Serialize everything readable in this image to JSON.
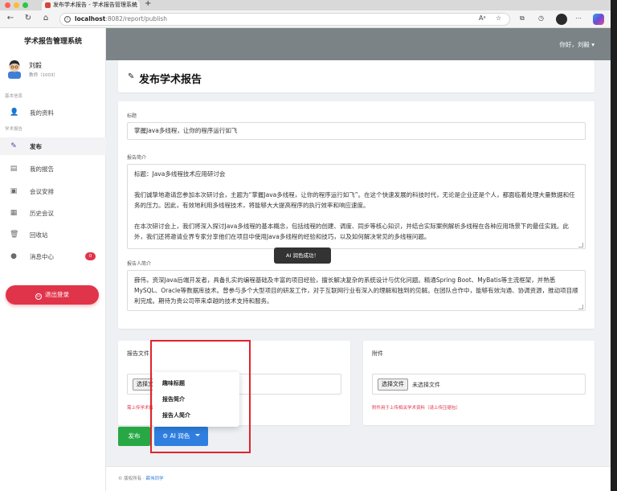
{
  "browser": {
    "tab_title": "发布学术报告 - 学术报告管理系统",
    "url_host": "localhost",
    "url_rest": ":8082/report/publish",
    "traffic_colors": [
      "#ff5f57",
      "#febc2e",
      "#28c840"
    ]
  },
  "sidebar": {
    "brand": "学术报告管理系统",
    "user_name": "刘毅",
    "user_role": "教师（1003）",
    "section_basic": "基本信息",
    "section_reports": "学术报告",
    "items": [
      {
        "label": "我的资料",
        "icon": "user-icon",
        "glyph": "👤"
      },
      {
        "label": "发布",
        "icon": "edit-icon",
        "glyph": "✎"
      },
      {
        "label": "我的报告",
        "icon": "report-icon",
        "glyph": "▤"
      },
      {
        "label": "会议安排",
        "icon": "calendar-icon",
        "glyph": "▣"
      },
      {
        "label": "历史会议",
        "icon": "history-icon",
        "glyph": "▦"
      },
      {
        "label": "回收站",
        "icon": "trash-icon",
        "glyph": "🗑"
      },
      {
        "label": "消息中心",
        "icon": "message-icon",
        "glyph": "●"
      }
    ],
    "message_badge": "0",
    "logout_label": "退出登录",
    "active_color": "#4a3f9a",
    "logout_color": "#e0344a"
  },
  "header": {
    "greeting": "你好，刘毅",
    "greeting_caret": "▾",
    "page_title": "发布学术报告"
  },
  "form": {
    "title_label": "标题",
    "title_value": "掌握Java多线程，让你的程序运行如飞",
    "abstract_label": "报告简介",
    "abstract_p1": "标题：Java多线程技术应用研讨会",
    "abstract_p2": "我们诚挚地邀请您参加本次研讨会，主题为“掌握Java多线程，让你的程序运行如飞”。在这个快速发展的科技时代，无论是企业还是个人，都面临着处理大量数据和任务的压力。因此，有效地利用多线程技术，将能够大大提高程序的执行效率和响应速度。",
    "abstract_p3": "在本次研讨会上，我们将深入探讨Java多线程的基本概念，包括线程的创建、调度、同步等核心知识，并结合实际案例解析多线程在各种应用场景下的最佳实践。此外，我们还将邀请业界专家分享他们在项目中使用Java多线程的经验和技巧，以及如何解决常见的多线程问题。",
    "speaker_label": "报告人简介",
    "speaker_value": "薛伟，资深Java后端开发者，具备扎实的编程基础及丰富的项目经验，擅长解决复杂的系统设计与优化问题。精通Spring Boot、MyBatis等主流框架，并熟悉MySQL、Oracle等数据库技术。曾参与多个大型项目的研发工作，对于互联网行业有深入的理解和独到的见解。在团队合作中，能够有效沟通、协调资源，推动项目顺利完成。期待为贵公司带来卓越的技术支持和服务。",
    "toast": "AI 润色成功！"
  },
  "uploads": {
    "report_title": "报告文件",
    "report_button": "选择文件",
    "report_hint": "需上传学术报告",
    "attach_title": "附件",
    "attach_button": "选择文件",
    "attach_status": "未选择文件",
    "attach_hint": "附件用于上传相关学术资料（请上传压缩包）"
  },
  "actions": {
    "publish_label": "发布",
    "ai_label": "AI 润色",
    "ai_icon": "⚙",
    "publish_color": "#27a844",
    "ai_color": "#2f7fe0"
  },
  "ai_menu": {
    "items": [
      "趣味标题",
      "报告简介",
      "报告人简介"
    ]
  },
  "footer": {
    "copyright": "© 版权所有 · ",
    "author": "薛伟同学"
  }
}
